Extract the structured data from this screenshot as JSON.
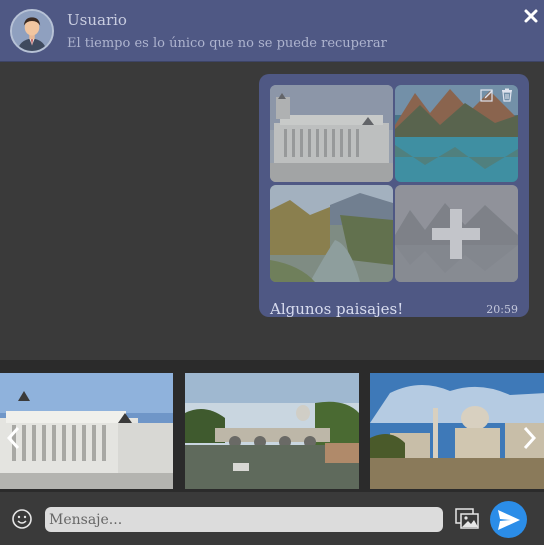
{
  "header": {
    "user_name": "Usuario",
    "status": "El tiempo es lo único que no se puede recuperar",
    "close_icon": "close-icon",
    "avatar_icon": "avatar-icon"
  },
  "message": {
    "images": [
      {
        "subject": "monument"
      },
      {
        "subject": "mountain-lake"
      },
      {
        "subject": "river-forest"
      },
      {
        "subject": "misty-lake",
        "overlay": "plus-icon"
      }
    ],
    "actions": [
      "edit-icon",
      "trash-icon"
    ],
    "caption": "Algunos paisajes!",
    "time": "20:59"
  },
  "carousel": {
    "slides": [
      {
        "subject": "monument"
      },
      {
        "subject": "river-bridge"
      },
      {
        "subject": "ruins"
      }
    ],
    "prev_icon": "chevron-left-icon",
    "next_icon": "chevron-right-icon"
  },
  "input": {
    "placeholder": "Mensaje...",
    "value": "",
    "emoji_icon": "emoji-icon",
    "gallery_icon": "gallery-icon",
    "send_icon": "send-icon"
  },
  "colors": {
    "header_bg": "#4f5884",
    "bubble_bg": "#4f5884",
    "background": "#3a3a3a",
    "carousel_bg": "#2b2b2b",
    "send_button": "#2b8de8"
  }
}
